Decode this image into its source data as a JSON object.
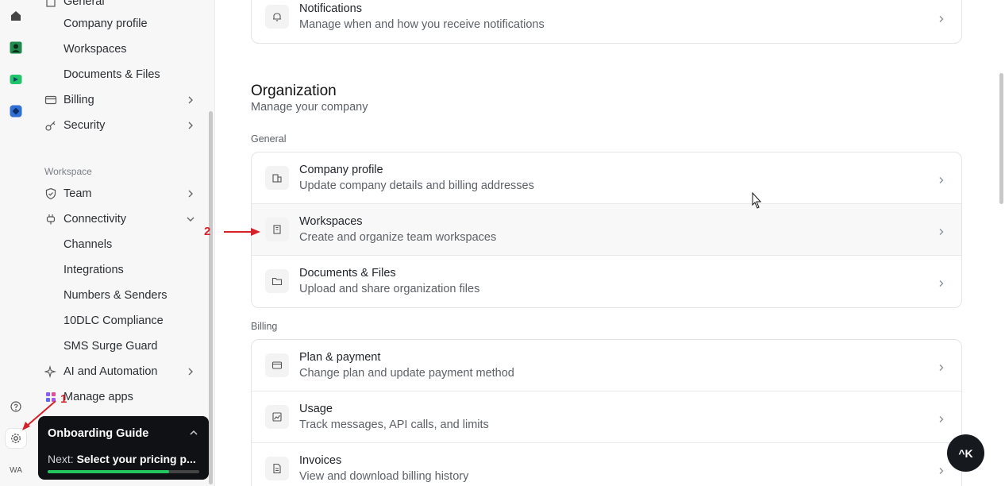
{
  "rail": {
    "avatar": "WA"
  },
  "sidebar": {
    "top_cut": "General",
    "general_subs": [
      "Company profile",
      "Workspaces",
      "Documents & Files"
    ],
    "billing": "Billing",
    "security": "Security",
    "workspace_section": "Workspace",
    "team": "Team",
    "connectivity": "Connectivity",
    "connectivity_subs": [
      "Channels",
      "Integrations",
      "Numbers & Senders",
      "10DLC Compliance",
      "SMS Surge Guard"
    ],
    "ai": "AI and Automation",
    "manage_apps": "Manage apps"
  },
  "onboarding": {
    "title": "Onboarding Guide",
    "next_label": "Next:",
    "next_value": "Select your pricing p...",
    "progress": 0.8
  },
  "main": {
    "notifications": {
      "title": "Notifications",
      "desc": "Manage when and how you receive notifications"
    },
    "org_title": "Organization",
    "org_sub": "Manage your company",
    "general_label": "General",
    "general_rows": [
      {
        "title": "Company profile",
        "desc": "Update company details and billing addresses"
      },
      {
        "title": "Workspaces",
        "desc": "Create and organize team workspaces"
      },
      {
        "title": "Documents & Files",
        "desc": "Upload and share organization files"
      }
    ],
    "billing_label": "Billing",
    "billing_rows": [
      {
        "title": "Plan & payment",
        "desc": "Change plan and update payment method"
      },
      {
        "title": "Usage",
        "desc": "Track messages, API calls, and limits"
      },
      {
        "title": "Invoices",
        "desc": "View and download billing history"
      }
    ]
  },
  "kbar": "^K",
  "annotations": {
    "one": "1",
    "two": "2"
  },
  "colors": {
    "accent_red": "#d6202a",
    "progress_green": "#22c55e"
  }
}
